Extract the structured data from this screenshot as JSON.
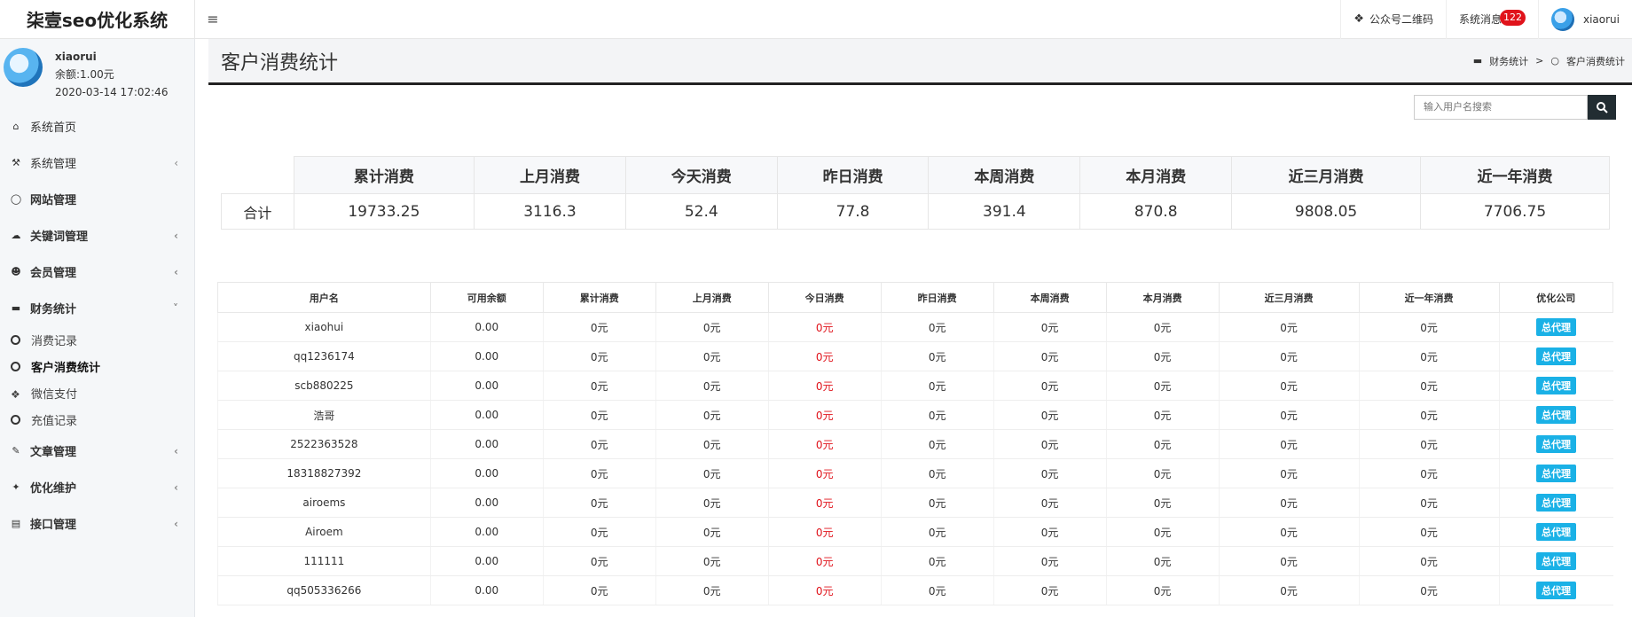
{
  "app": {
    "title": "柒壹seo优化系统",
    "toggle_icon": "hamburger-icon"
  },
  "topbar": {
    "qrcode_label": "公众号二维码",
    "messages_label": "系统消息",
    "messages_count": "122",
    "username": "xiaorui"
  },
  "user": {
    "name": "xiaorui",
    "balance": "余额:1.00元",
    "last_login": "2020-03-14 17:02:46"
  },
  "sidebar": {
    "items": [
      {
        "label": "系统首页",
        "icon": "home-icon"
      },
      {
        "label": "系统管理",
        "icon": "wrench-icon"
      },
      {
        "label": "网站管理",
        "icon": "circle-icon"
      },
      {
        "label": "关键词管理",
        "icon": "cloud-icon"
      },
      {
        "label": "会员管理",
        "icon": "users-icon"
      },
      {
        "label": "财务统计",
        "icon": "card-icon"
      },
      {
        "label": "文章管理",
        "icon": "edit-icon"
      },
      {
        "label": "优化维护",
        "icon": "magic-icon"
      },
      {
        "label": "接口管理",
        "icon": "book-icon"
      }
    ],
    "finance_sub": [
      {
        "label": "消费记录"
      },
      {
        "label": "客户消费统计"
      },
      {
        "label": "微信支付"
      },
      {
        "label": "充值记录"
      }
    ]
  },
  "page": {
    "title": "客户消费统计",
    "breadcrumb_parent": "财务统计",
    "breadcrumb_current": "客户消费统计"
  },
  "search": {
    "placeholder": "输入用户名搜索"
  },
  "summary": {
    "headers": [
      "累计消费",
      "上月消费",
      "今天消费",
      "昨日消费",
      "本周消费",
      "本月消费",
      "近三月消费",
      "近一年消费"
    ],
    "row_label": "合计",
    "values": [
      "19733.25",
      "3116.3",
      "52.4",
      "77.8",
      "391.4",
      "870.8",
      "9808.05",
      "7706.75"
    ]
  },
  "detail": {
    "headers": [
      "用户名",
      "可用余额",
      "累计消费",
      "上月消费",
      "今日消费",
      "昨日消费",
      "本周消费",
      "本月消费",
      "近三月消费",
      "近一年消费",
      "优化公司"
    ],
    "rows": [
      [
        "xiaohui",
        "0.00",
        "0元",
        "0元",
        "0元",
        "0元",
        "0元",
        "0元",
        "0元",
        "0元",
        "总代理"
      ],
      [
        "qq1236174",
        "0.00",
        "0元",
        "0元",
        "0元",
        "0元",
        "0元",
        "0元",
        "0元",
        "0元",
        "总代理"
      ],
      [
        "scb880225",
        "0.00",
        "0元",
        "0元",
        "0元",
        "0元",
        "0元",
        "0元",
        "0元",
        "0元",
        "总代理"
      ],
      [
        "浩哥",
        "0.00",
        "0元",
        "0元",
        "0元",
        "0元",
        "0元",
        "0元",
        "0元",
        "0元",
        "总代理"
      ],
      [
        "2522363528",
        "0.00",
        "0元",
        "0元",
        "0元",
        "0元",
        "0元",
        "0元",
        "0元",
        "0元",
        "总代理"
      ],
      [
        "18318827392",
        "0.00",
        "0元",
        "0元",
        "0元",
        "0元",
        "0元",
        "0元",
        "0元",
        "0元",
        "总代理"
      ],
      [
        "airoems",
        "0.00",
        "0元",
        "0元",
        "0元",
        "0元",
        "0元",
        "0元",
        "0元",
        "0元",
        "总代理"
      ],
      [
        "Airoem",
        "0.00",
        "0元",
        "0元",
        "0元",
        "0元",
        "0元",
        "0元",
        "0元",
        "0元",
        "总代理"
      ],
      [
        "111111",
        "0.00",
        "0元",
        "0元",
        "0元",
        "0元",
        "0元",
        "0元",
        "0元",
        "0元",
        "总代理"
      ],
      [
        "qq505336266",
        "0.00",
        "0元",
        "0元",
        "0元",
        "0元",
        "0元",
        "0元",
        "0元",
        "0元",
        "总代理"
      ]
    ]
  },
  "colors": {
    "accent_red": "#e0131b",
    "tag_blue": "#1ab1e6",
    "dark": "#222d32"
  }
}
